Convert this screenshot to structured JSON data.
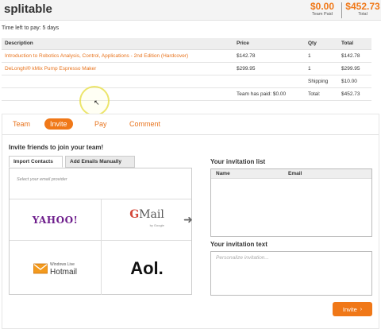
{
  "header": {
    "logo": "splitable",
    "team_paid_amount": "$0.00",
    "team_paid_label": "Team Paid",
    "total_amount": "$452.73",
    "total_label": "Total"
  },
  "time_left": "Time left to pay: 5 days",
  "order": {
    "columns": [
      "Description",
      "Price",
      "Qty",
      "Total"
    ],
    "rows": [
      {
        "description": "Introduction to Robotics Analysis, Control, Applications - 2nd Edition (Hardcover)",
        "price": "$142.78",
        "qty": "1",
        "total": "$142.78"
      },
      {
        "description": "DeLonghi® kMix Pump Espresso Maker",
        "price": "$299.95",
        "qty": "1",
        "total": "$299.95"
      }
    ],
    "shipping_label": "Shipping",
    "shipping_value": "$10.00",
    "team_paid_text": "Team has paid: $0.00",
    "total_label": "Total:",
    "total_value": "$452.73"
  },
  "tabs": [
    {
      "label": "Team"
    },
    {
      "label": "Invite"
    },
    {
      "label": "Pay"
    },
    {
      "label": "Comment"
    }
  ],
  "invite": {
    "heading": "Invite friends to join your team!",
    "subtab_import": "Import Contacts",
    "subtab_manual": "Add Emails Manually",
    "provider_hint": "Select your email provider",
    "providers": {
      "yahoo": "YAHOO!",
      "gmail_g": "G",
      "gmail_rest": "Mail",
      "gmail_sub": "by Google",
      "hotmail_top": "Windows Live",
      "hotmail_main": "Hotmail",
      "aol": "Aol."
    }
  },
  "invitation_list": {
    "heading": "Your invitation list",
    "col_name": "Name",
    "col_email": "Email"
  },
  "invitation_text": {
    "heading": "Your invitation text",
    "placeholder": "Personalize invitation..."
  },
  "invite_button": "Invite",
  "colors": {
    "accent": "#f07818",
    "link": "#e8731c",
    "yahoo": "#6e1e8c",
    "gmail_red": "#d44638"
  },
  "icons": {
    "arrow": "arrow-right-icon",
    "cursor": "mouse-cursor-icon",
    "button_chevron": "chevron-right-icon"
  }
}
